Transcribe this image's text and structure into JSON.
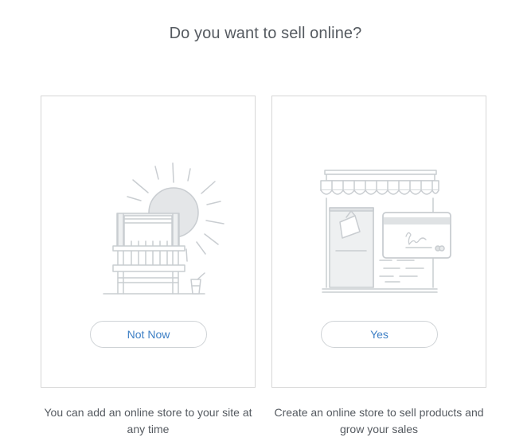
{
  "heading": "Do you want to sell online?",
  "options": [
    {
      "id": "not-now",
      "button_label": "Not Now",
      "description": "You can add an online store to your site at any time"
    },
    {
      "id": "yes",
      "button_label": "Yes",
      "description": "Create an online store to sell products and grow your sales"
    }
  ],
  "colors": {
    "heading": "#555a60",
    "accent": "#3d7fc5",
    "border": "#d6d6d6",
    "illustration": "#c9cdd1"
  },
  "icons": {
    "left_card": "beach-chair-sun-icon",
    "right_card": "storefront-credit-card-icon"
  }
}
